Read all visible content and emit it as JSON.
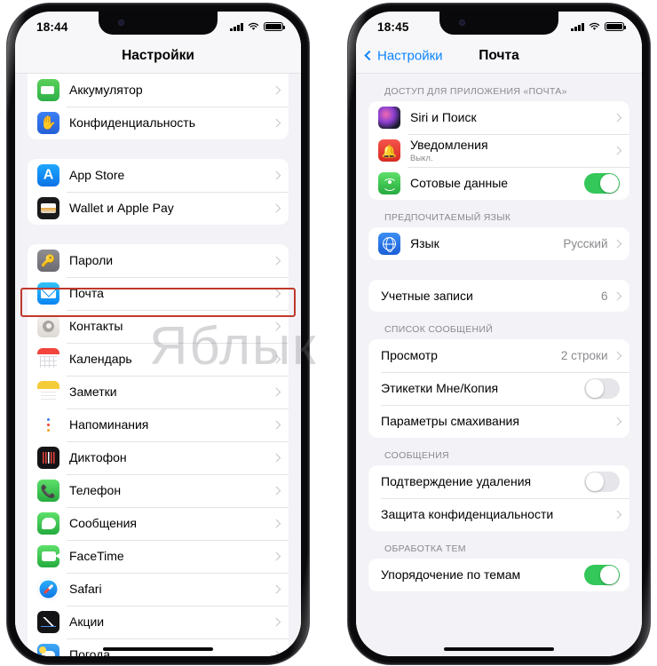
{
  "watermark": "Яблык",
  "left_phone": {
    "status": {
      "time": "18:44",
      "signal_icon": "cellular-bars-icon",
      "wifi_icon": "wifi-icon",
      "battery_icon": "battery-icon"
    },
    "navbar": {
      "title": "Настройки"
    },
    "groups": [
      {
        "rows": [
          {
            "label": "Аккумулятор",
            "icon": "battery-app-icon",
            "accessory": "chevron"
          },
          {
            "label": "Конфиденциальность",
            "icon": "privacy-hand-icon",
            "accessory": "chevron"
          }
        ]
      },
      {
        "rows": [
          {
            "label": "App Store",
            "icon": "app-store-icon",
            "accessory": "chevron"
          },
          {
            "label": "Wallet и Apple Pay",
            "icon": "wallet-icon",
            "accessory": "chevron"
          }
        ]
      },
      {
        "rows": [
          {
            "label": "Пароли",
            "icon": "passwords-key-icon",
            "accessory": "chevron"
          },
          {
            "label": "Почта",
            "icon": "mail-icon",
            "accessory": "chevron",
            "highlighted": true
          },
          {
            "label": "Контакты",
            "icon": "contacts-icon",
            "accessory": "chevron"
          },
          {
            "label": "Календарь",
            "icon": "calendar-icon",
            "accessory": "chevron"
          },
          {
            "label": "Заметки",
            "icon": "notes-icon",
            "accessory": "chevron"
          },
          {
            "label": "Напоминания",
            "icon": "reminders-icon",
            "accessory": "chevron"
          },
          {
            "label": "Диктофон",
            "icon": "voice-memos-icon",
            "accessory": "chevron"
          },
          {
            "label": "Телефон",
            "icon": "phone-icon",
            "accessory": "chevron"
          },
          {
            "label": "Сообщения",
            "icon": "messages-icon",
            "accessory": "chevron"
          },
          {
            "label": "FaceTime",
            "icon": "facetime-icon",
            "accessory": "chevron"
          },
          {
            "label": "Safari",
            "icon": "safari-icon",
            "accessory": "chevron"
          },
          {
            "label": "Акции",
            "icon": "stocks-icon",
            "accessory": "chevron"
          },
          {
            "label": "Погода",
            "icon": "weather-icon",
            "accessory": "chevron"
          }
        ]
      }
    ]
  },
  "right_phone": {
    "status": {
      "time": "18:45",
      "signal_icon": "cellular-bars-icon",
      "wifi_icon": "wifi-icon",
      "battery_icon": "battery-icon"
    },
    "navbar": {
      "back_label": "Настройки",
      "back_icon": "chevron-left-icon",
      "title": "Почта"
    },
    "sections": [
      {
        "header": "ДОСТУП ДЛЯ ПРИЛОЖЕНИЯ «ПОЧТА»",
        "rows": [
          {
            "label": "Siri и Поиск",
            "icon": "siri-icon",
            "accessory": "chevron"
          },
          {
            "label": "Уведомления",
            "sublabel": "Выкл.",
            "icon": "notifications-bell-icon",
            "accessory": "chevron"
          },
          {
            "label": "Сотовые данные",
            "icon": "cellular-data-icon",
            "accessory": "toggle",
            "toggle_on": true
          }
        ]
      },
      {
        "header": "ПРЕДПОЧИТАЕМЫЙ ЯЗЫК",
        "rows": [
          {
            "label": "Язык",
            "icon": "language-globe-icon",
            "value": "Русский",
            "accessory": "chevron"
          }
        ]
      },
      {
        "header": "",
        "rows": [
          {
            "label": "Учетные записи",
            "value": "6",
            "accessory": "chevron",
            "highlighted": true
          }
        ]
      },
      {
        "header": "СПИСОК СООБЩЕНИЙ",
        "rows": [
          {
            "label": "Просмотр",
            "value": "2 строки",
            "accessory": "chevron"
          },
          {
            "label": "Этикетки Мне/Копия",
            "accessory": "toggle",
            "toggle_on": false
          },
          {
            "label": "Параметры смахивания",
            "accessory": "chevron"
          }
        ]
      },
      {
        "header": "СООБЩЕНИЯ",
        "rows": [
          {
            "label": "Подтверждение удаления",
            "accessory": "toggle",
            "toggle_on": false
          },
          {
            "label": "Защита конфиденциальности",
            "accessory": "chevron"
          }
        ]
      },
      {
        "header": "ОБРАБОТКА ТЕМ",
        "rows": [
          {
            "label": "Упорядочение по темам",
            "accessory": "toggle",
            "toggle_on": true
          }
        ]
      }
    ]
  },
  "colors": {
    "highlight_border": "#c0392b",
    "accent_blue": "#0a84ff",
    "toggle_on": "#34c759",
    "screen_bg": "#f2f2f7"
  }
}
